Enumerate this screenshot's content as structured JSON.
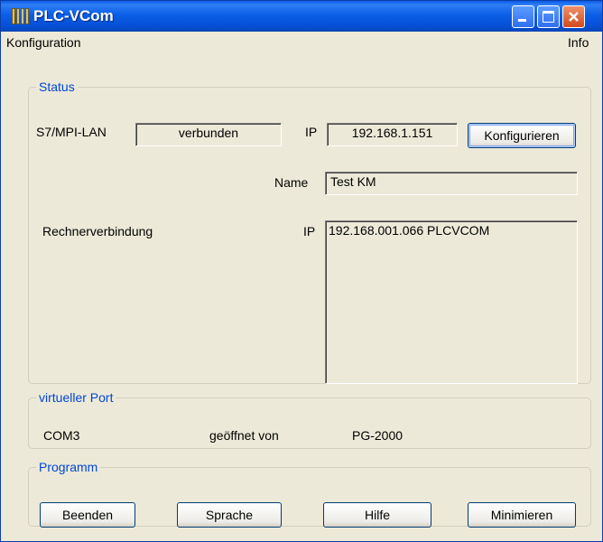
{
  "window": {
    "title": "PLC-VCom"
  },
  "menu": {
    "left": "Konfiguration",
    "right": "Info"
  },
  "status": {
    "legend": "Status",
    "s7_label": "S7/MPI-LAN",
    "s7_value": "verbunden",
    "ip_label": "IP",
    "ip_value": "192.168.1.151",
    "configure_button": "Konfigurieren",
    "name_label": "Name",
    "name_value": "Test KM",
    "rechner_label": "Rechnerverbindung",
    "rechner_ip_label": "IP",
    "rechner_list": [
      "192.168.001.066 PLCVCOM"
    ]
  },
  "port": {
    "legend": "virtueller Port",
    "com": "COM3",
    "opened_by_label": "geöffnet von",
    "opened_by_value": "PG-2000"
  },
  "program": {
    "legend": "Programm",
    "buttons": [
      "Beenden",
      "Sprache",
      "Hilfe",
      "Minimieren"
    ]
  }
}
